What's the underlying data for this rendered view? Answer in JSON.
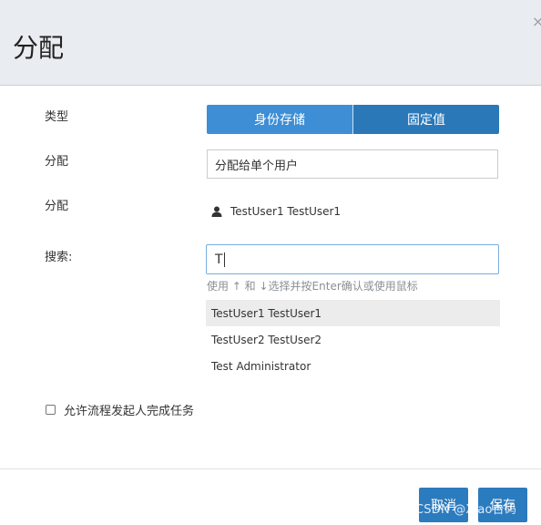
{
  "dialog": {
    "title": "分配",
    "close_symbol": "×"
  },
  "form": {
    "type_label": "类型",
    "type_options": [
      "身份存储",
      "固定值"
    ],
    "assign_label": "分配",
    "assign_select_value": "分配给单个用户",
    "assigned_label": "分配",
    "assigned_user": "TestUser1 TestUser1",
    "search_label": "搜索:",
    "search_value": "T",
    "search_hint": "使用 ↑ 和 ↓选择并按Enter确认或使用鼠标",
    "results": [
      "TestUser1 TestUser1",
      "TestUser2 TestUser2",
      "Test Administrator"
    ],
    "allow_initiator_label": "允许流程发起人完成任务",
    "allow_initiator_checked": false
  },
  "footer": {
    "cancel_label": "取消",
    "save_label": "保存"
  },
  "watermark": "CSDN @Xiao台码",
  "colors": {
    "primary": "#2b7bbf",
    "segment_active": "#3d8ed4",
    "header_bg": "#e9ecf0"
  }
}
